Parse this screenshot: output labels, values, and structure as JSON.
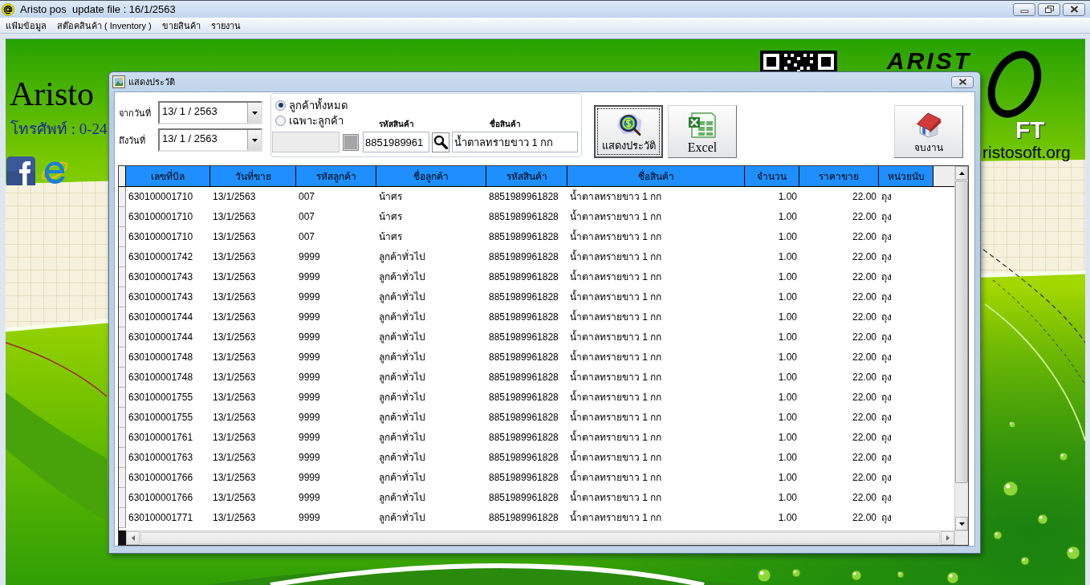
{
  "window": {
    "title": "Aristo pos  update file : 16/1/2563"
  },
  "menu": [
    "แฟ้มข้อมูล",
    "สต๊อคสินค้า ( Inventory )",
    "ขายสินค้า",
    "รายงาน"
  ],
  "backdrop": {
    "heading": "Aristo",
    "phone": "โทรศัพท์ : 0-24",
    "logo_text": "ARIST",
    "logo_suffix": "FT",
    "website": "ristosoft.org"
  },
  "dialog": {
    "title": "แสดงประวัติ",
    "from_label": "จากวันที่",
    "from_date": "13/ 1 / 2563",
    "to_label": "ถึงวันที่",
    "to_date": "13/ 1 / 2563",
    "customer_options": [
      {
        "label": "ลูกค้าทั้งหมด",
        "selected": true
      },
      {
        "label": "เฉพาะลูกค้า",
        "selected": false
      }
    ],
    "customer_field": {
      "disabled": true
    },
    "product_code_label": "รหัสสินค้า",
    "product_code": "8851989961",
    "product_name_label": "ชื่อสินค้า",
    "product_name": "น้ำตาลทรายขาว 1 กก",
    "buttons": [
      {
        "kind": "history",
        "label": "แสดงประวัติ",
        "focused": true
      },
      {
        "kind": "excel",
        "label": "Excel",
        "focused": false
      },
      {
        "kind": "exit",
        "label": "จบงาน",
        "focused": false
      }
    ],
    "table": {
      "columns": [
        "เลขที่บิล",
        "วันที่ขาย",
        "รหัสลูกค้า",
        "ชื่อลูกค้า",
        "รหัสสินค้า",
        "ชื่อสินค้า",
        "จำนวน",
        "ราคาขาย",
        "หน่วยนับ"
      ],
      "rows": [
        [
          "630100001710",
          "13/1/2563",
          "007",
          "น้าศร",
          "8851989961828",
          "น้ำตาลทรายขาว 1 กก",
          "1.00",
          "22.00",
          "ถุง"
        ],
        [
          "630100001710",
          "13/1/2563",
          "007",
          "น้าศร",
          "8851989961828",
          "น้ำตาลทรายขาว 1 กก",
          "1.00",
          "22.00",
          "ถุง"
        ],
        [
          "630100001710",
          "13/1/2563",
          "007",
          "น้าศร",
          "8851989961828",
          "น้ำตาลทรายขาว 1 กก",
          "1.00",
          "22.00",
          "ถุง"
        ],
        [
          "630100001742",
          "13/1/2563",
          "9999",
          "ลูกค้าทั่วไป",
          "8851989961828",
          "น้ำตาลทรายขาว 1 กก",
          "1.00",
          "22.00",
          "ถุง"
        ],
        [
          "630100001743",
          "13/1/2563",
          "9999",
          "ลูกค้าทั่วไป",
          "8851989961828",
          "น้ำตาลทรายขาว 1 กก",
          "1.00",
          "22.00",
          "ถุง"
        ],
        [
          "630100001743",
          "13/1/2563",
          "9999",
          "ลูกค้าทั่วไป",
          "8851989961828",
          "น้ำตาลทรายขาว 1 กก",
          "1.00",
          "22.00",
          "ถุง"
        ],
        [
          "630100001744",
          "13/1/2563",
          "9999",
          "ลูกค้าทั่วไป",
          "8851989961828",
          "น้ำตาลทรายขาว 1 กก",
          "1.00",
          "22.00",
          "ถุง"
        ],
        [
          "630100001744",
          "13/1/2563",
          "9999",
          "ลูกค้าทั่วไป",
          "8851989961828",
          "น้ำตาลทรายขาว 1 กก",
          "1.00",
          "22.00",
          "ถุง"
        ],
        [
          "630100001748",
          "13/1/2563",
          "9999",
          "ลูกค้าทั่วไป",
          "8851989961828",
          "น้ำตาลทรายขาว 1 กก",
          "1.00",
          "22.00",
          "ถุง"
        ],
        [
          "630100001748",
          "13/1/2563",
          "9999",
          "ลูกค้าทั่วไป",
          "8851989961828",
          "น้ำตาลทรายขาว 1 กก",
          "1.00",
          "22.00",
          "ถุง"
        ],
        [
          "630100001755",
          "13/1/2563",
          "9999",
          "ลูกค้าทั่วไป",
          "8851989961828",
          "น้ำตาลทรายขาว 1 กก",
          "1.00",
          "22.00",
          "ถุง"
        ],
        [
          "630100001755",
          "13/1/2563",
          "9999",
          "ลูกค้าทั่วไป",
          "8851989961828",
          "น้ำตาลทรายขาว 1 กก",
          "1.00",
          "22.00",
          "ถุง"
        ],
        [
          "630100001761",
          "13/1/2563",
          "9999",
          "ลูกค้าทั่วไป",
          "8851989961828",
          "น้ำตาลทรายขาว 1 กก",
          "1.00",
          "22.00",
          "ถุง"
        ],
        [
          "630100001763",
          "13/1/2563",
          "9999",
          "ลูกค้าทั่วไป",
          "8851989961828",
          "น้ำตาลทรายขาว 1 กก",
          "1.00",
          "22.00",
          "ถุง"
        ],
        [
          "630100001766",
          "13/1/2563",
          "9999",
          "ลูกค้าทั่วไป",
          "8851989961828",
          "น้ำตาลทรายขาว 1 กก",
          "1.00",
          "22.00",
          "ถุง"
        ],
        [
          "630100001766",
          "13/1/2563",
          "9999",
          "ลูกค้าทั่วไป",
          "8851989961828",
          "น้ำตาลทรายขาว 1 กก",
          "1.00",
          "22.00",
          "ถุง"
        ],
        [
          "630100001771",
          "13/1/2563",
          "9999",
          "ลูกค้าทั่วไป",
          "8851989961828",
          "น้ำตาลทรายขาว 1 กก",
          "1.00",
          "22.00",
          "ถุง"
        ]
      ]
    }
  }
}
